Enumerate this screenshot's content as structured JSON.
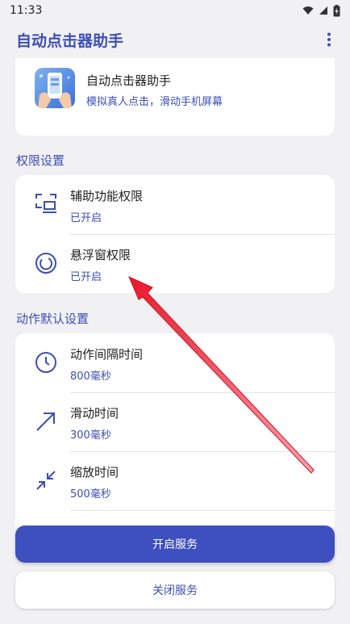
{
  "status_bar": {
    "time": "11:33",
    "icons": [
      "wifi-icon",
      "signal-icon",
      "battery-charging-icon"
    ]
  },
  "app_bar": {
    "title": "自动点击器助手",
    "menu_icon": "more-vert-icon"
  },
  "app_card": {
    "name": "自动点击器助手",
    "description": "模拟真人点击，滑动手机屏幕",
    "logo_icon": "phone-touch-logo"
  },
  "permissions": {
    "title": "权限设置",
    "items": [
      {
        "label": "辅助功能权限",
        "status": "已开启",
        "icon": "accessibility-screen-icon"
      },
      {
        "label": "悬浮窗权限",
        "status": "已开启",
        "icon": "floating-window-icon"
      }
    ]
  },
  "defaults": {
    "title": "动作默认设置",
    "items": [
      {
        "label": "动作间隔时间",
        "value": "800毫秒",
        "icon": "clock-icon"
      },
      {
        "label": "滑动时间",
        "value": "300毫秒",
        "icon": "arrow-diagonal-icon"
      },
      {
        "label": "缩放时间",
        "value": "500毫秒",
        "icon": "pinch-zoom-icon"
      }
    ]
  },
  "buttons": {
    "start": "开启服务",
    "stop": "关闭服务"
  },
  "colors": {
    "accent": "#3d4eb6",
    "primary_button": "#3e4fc0",
    "background": "#f1f1f4",
    "annotation_arrow": "#e8192c"
  }
}
